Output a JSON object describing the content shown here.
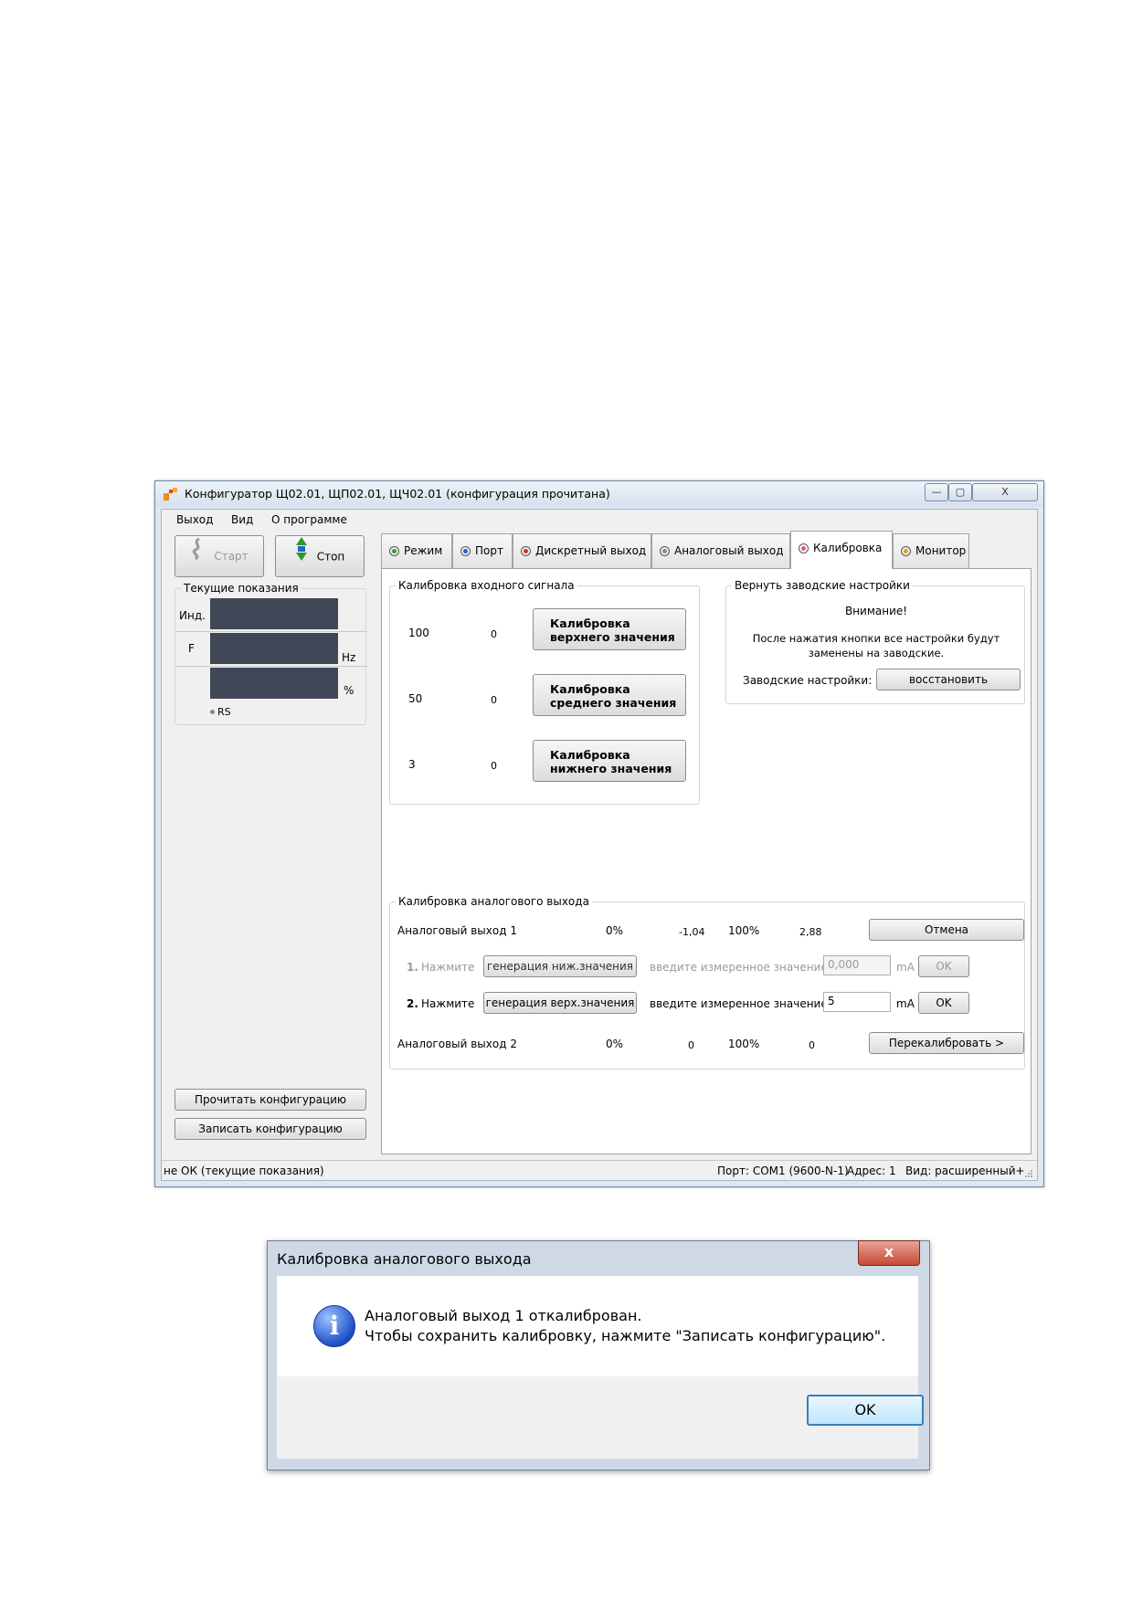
{
  "window": {
    "title": "Конфигуратор Щ02.01, ЩП02.01, ЩЧ02.01 (конфигурация прочитана)",
    "minimize": "—",
    "maximize": "▢",
    "close": "X"
  },
  "menu": [
    "Выход",
    "Вид",
    "О программе"
  ],
  "toolbar": {
    "start": "Старт",
    "stop": "Стоп"
  },
  "readings": {
    "title": "Текущие показания",
    "ind_label": "Инд.",
    "f_label": "F",
    "hz_unit": "Hz",
    "pct_unit": "%",
    "rs": "RS"
  },
  "tabs": [
    {
      "label": "Режим",
      "color": "#2aa52a"
    },
    {
      "label": "Порт",
      "color": "#2a5fd6"
    },
    {
      "label": "Дискретный выход",
      "color": "#d63030"
    },
    {
      "label": "Аналоговый выход",
      "color": "#8a8a8a"
    },
    {
      "label": "Калибровка",
      "color": "#e05a8a"
    },
    {
      "label": "Монитор",
      "color": "#e0a020"
    }
  ],
  "input_calibration": {
    "title": "Калибровка входного сигнала",
    "rows": [
      {
        "value": "100",
        "reading": "0",
        "btn_line1": "Калибровка",
        "btn_line2": "верхнего значения"
      },
      {
        "value": "50",
        "reading": "0",
        "btn_line1": "Калибровка",
        "btn_line2": "среднего значения"
      },
      {
        "value": "3",
        "reading": "0",
        "btn_line1": "Калибровка",
        "btn_line2": "нижнего значения"
      }
    ]
  },
  "factory": {
    "title": "Вернуть заводские настройки",
    "attention": "Внимание!",
    "warning_line1": "После нажатия кнопки все настройки будут",
    "warning_line2": "заменены на заводские.",
    "label": "Заводские настройки:",
    "button": "восстановить"
  },
  "analog_calibration": {
    "title": "Калибровка аналогового выхода",
    "out1": {
      "label": "Аналоговый выход 1",
      "p0": "0%",
      "v0": "-1,04",
      "p100": "100%",
      "v100": "2,88",
      "button": "Отмена"
    },
    "step1": {
      "num": "1.",
      "text": "Нажмите",
      "button": "генерация ниж.значения",
      "prompt": "введите измеренное значение",
      "value": "0,000",
      "unit": "mA",
      "ok": "OK"
    },
    "step2": {
      "num": "2.",
      "text": "Нажмите",
      "button": "генерация верх.значения",
      "prompt": "введите измеренное значение",
      "value": "5",
      "unit": "mA",
      "ok": "OK"
    },
    "out2": {
      "label": "Аналоговый выход 2",
      "p0": "0%",
      "v0": "0",
      "p100": "100%",
      "v100": "0",
      "button": "Перекалибровать >"
    }
  },
  "config_buttons": {
    "read": "Прочитать конфигурацию",
    "write": "Записать конфигурацию"
  },
  "status": {
    "left": "не ОК (текущие показания)",
    "port": "Порт: COM1 (9600-N-1)",
    "address": "Адрес: 1",
    "view": "Вид: расширенный+"
  },
  "dialog": {
    "title": "Калибровка аналогового выхода",
    "close": "x",
    "icon": "i",
    "message_line1": "Аналоговый выход 1 откалиброван.",
    "message_line2": "Чтобы сохранить калибровку, нажмите \"Записать конфигурацию\".",
    "ok": "OK"
  }
}
